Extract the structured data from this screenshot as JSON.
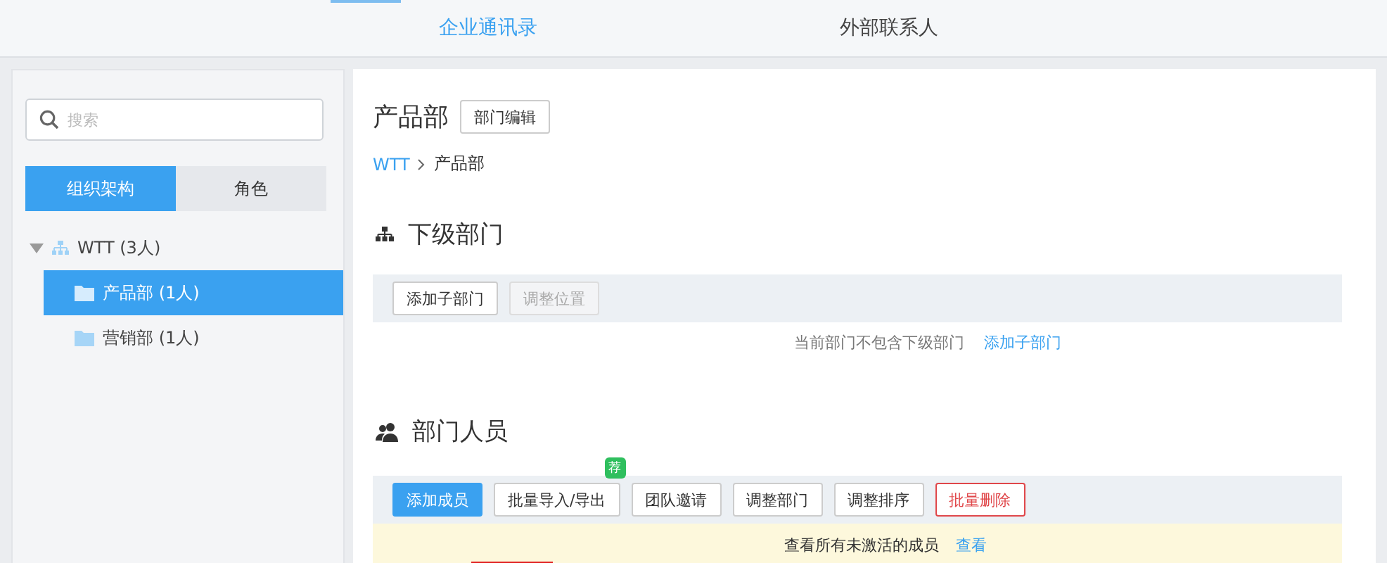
{
  "top_tabs": [
    {
      "label": "企业通讯录",
      "selected": true
    },
    {
      "label": "外部联系人",
      "selected": false
    }
  ],
  "sidebar": {
    "search": {
      "placeholder": "搜索"
    },
    "view_tabs": [
      {
        "label": "组织架构",
        "selected": true
      },
      {
        "label": "角色",
        "selected": false
      }
    ],
    "tree": [
      {
        "label": "WTT (3人)",
        "expanded": true,
        "selected": false,
        "children": [
          {
            "label": "产品部 (1人)",
            "selected": true
          },
          {
            "label": "营销部 (1人)",
            "selected": false
          }
        ]
      }
    ]
  },
  "main": {
    "title": "产品部",
    "title_button": "部门编辑",
    "breadcrumb": [
      {
        "label": "WTT",
        "link": true
      },
      {
        "label": "产品部",
        "link": false
      }
    ],
    "sub_section": {
      "heading": "下级部门",
      "buttons": [
        {
          "label": "添加子部门",
          "kind": "default"
        },
        {
          "label": "调整位置",
          "kind": "disabled"
        }
      ],
      "empty_text": "当前部门不包含下级部门",
      "empty_link": "添加子部门"
    },
    "members_section": {
      "heading": "部门人员",
      "buttons": [
        {
          "label": "添加成员",
          "kind": "primary"
        },
        {
          "label": "批量导入/导出",
          "kind": "default",
          "badge": "荐"
        },
        {
          "label": "团队邀请",
          "kind": "default"
        },
        {
          "label": "调整部门",
          "kind": "default"
        },
        {
          "label": "调整排序",
          "kind": "default"
        },
        {
          "label": "批量删除",
          "kind": "danger"
        }
      ],
      "notice_text": "查看所有未激活的成员",
      "notice_link": "查看"
    }
  }
}
